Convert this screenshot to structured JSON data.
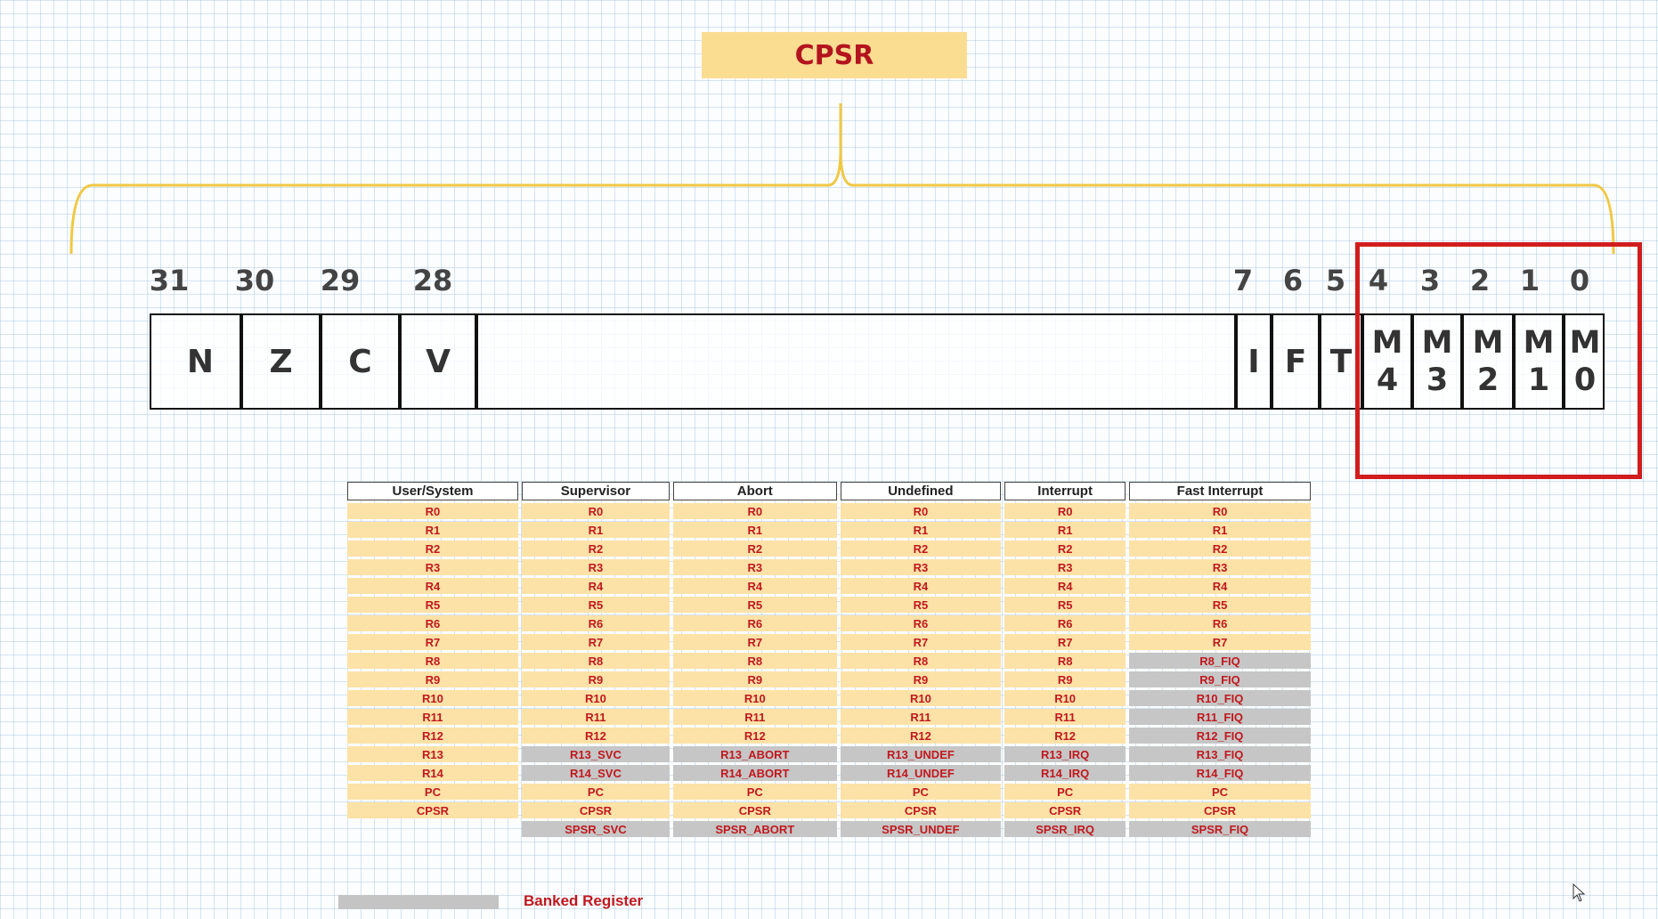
{
  "title": "CPSR",
  "bit_numbers": [
    "31",
    "30",
    "29",
    "28",
    "7",
    "6",
    "5",
    "4",
    "3",
    "2",
    "1",
    "0"
  ],
  "flags": [
    "N",
    "Z",
    "C",
    "V",
    "I",
    "F",
    "T"
  ],
  "mode_bits": [
    {
      "letter": "M",
      "digit": "4"
    },
    {
      "letter": "M",
      "digit": "3"
    },
    {
      "letter": "M",
      "digit": "2"
    },
    {
      "letter": "M",
      "digit": "1"
    },
    {
      "letter": "M",
      "digit": "0"
    }
  ],
  "table": {
    "headers": [
      "User/System",
      "Supervisor",
      "Abort",
      "Undefined",
      "Interrupt",
      "Fast Interrupt"
    ],
    "rows": [
      [
        {
          "t": "R0",
          "k": "u"
        },
        {
          "t": "R0",
          "k": "u"
        },
        {
          "t": "R0",
          "k": "u"
        },
        {
          "t": "R0",
          "k": "u"
        },
        {
          "t": "R0",
          "k": "u"
        },
        {
          "t": "R0",
          "k": "u"
        }
      ],
      [
        {
          "t": "R1",
          "k": "u"
        },
        {
          "t": "R1",
          "k": "u"
        },
        {
          "t": "R1",
          "k": "u"
        },
        {
          "t": "R1",
          "k": "u"
        },
        {
          "t": "R1",
          "k": "u"
        },
        {
          "t": "R1",
          "k": "u"
        }
      ],
      [
        {
          "t": "R2",
          "k": "u"
        },
        {
          "t": "R2",
          "k": "u"
        },
        {
          "t": "R2",
          "k": "u"
        },
        {
          "t": "R2",
          "k": "u"
        },
        {
          "t": "R2",
          "k": "u"
        },
        {
          "t": "R2",
          "k": "u"
        }
      ],
      [
        {
          "t": "R3",
          "k": "u"
        },
        {
          "t": "R3",
          "k": "u"
        },
        {
          "t": "R3",
          "k": "u"
        },
        {
          "t": "R3",
          "k": "u"
        },
        {
          "t": "R3",
          "k": "u"
        },
        {
          "t": "R3",
          "k": "u"
        }
      ],
      [
        {
          "t": "R4",
          "k": "u"
        },
        {
          "t": "R4",
          "k": "u"
        },
        {
          "t": "R4",
          "k": "u"
        },
        {
          "t": "R4",
          "k": "u"
        },
        {
          "t": "R4",
          "k": "u"
        },
        {
          "t": "R4",
          "k": "u"
        }
      ],
      [
        {
          "t": "R5",
          "k": "u"
        },
        {
          "t": "R5",
          "k": "u"
        },
        {
          "t": "R5",
          "k": "u"
        },
        {
          "t": "R5",
          "k": "u"
        },
        {
          "t": "R5",
          "k": "u"
        },
        {
          "t": "R5",
          "k": "u"
        }
      ],
      [
        {
          "t": "R6",
          "k": "u"
        },
        {
          "t": "R6",
          "k": "u"
        },
        {
          "t": "R6",
          "k": "u"
        },
        {
          "t": "R6",
          "k": "u"
        },
        {
          "t": "R6",
          "k": "u"
        },
        {
          "t": "R6",
          "k": "u"
        }
      ],
      [
        {
          "t": "R7",
          "k": "u"
        },
        {
          "t": "R7",
          "k": "u"
        },
        {
          "t": "R7",
          "k": "u"
        },
        {
          "t": "R7",
          "k": "u"
        },
        {
          "t": "R7",
          "k": "u"
        },
        {
          "t": "R7",
          "k": "u"
        }
      ],
      [
        {
          "t": "R8",
          "k": "u"
        },
        {
          "t": "R8",
          "k": "u"
        },
        {
          "t": "R8",
          "k": "u"
        },
        {
          "t": "R8",
          "k": "u"
        },
        {
          "t": "R8",
          "k": "u"
        },
        {
          "t": "R8_FIQ",
          "k": "b"
        }
      ],
      [
        {
          "t": "R9",
          "k": "u"
        },
        {
          "t": "R9",
          "k": "u"
        },
        {
          "t": "R9",
          "k": "u"
        },
        {
          "t": "R9",
          "k": "u"
        },
        {
          "t": "R9",
          "k": "u"
        },
        {
          "t": "R9_FIQ",
          "k": "b"
        }
      ],
      [
        {
          "t": "R10",
          "k": "u"
        },
        {
          "t": "R10",
          "k": "u"
        },
        {
          "t": "R10",
          "k": "u"
        },
        {
          "t": "R10",
          "k": "u"
        },
        {
          "t": "R10",
          "k": "u"
        },
        {
          "t": "R10_FIQ",
          "k": "b"
        }
      ],
      [
        {
          "t": "R11",
          "k": "u"
        },
        {
          "t": "R11",
          "k": "u"
        },
        {
          "t": "R11",
          "k": "u"
        },
        {
          "t": "R11",
          "k": "u"
        },
        {
          "t": "R11",
          "k": "u"
        },
        {
          "t": "R11_FIQ",
          "k": "b"
        }
      ],
      [
        {
          "t": "R12",
          "k": "u"
        },
        {
          "t": "R12",
          "k": "u"
        },
        {
          "t": "R12",
          "k": "u"
        },
        {
          "t": "R12",
          "k": "u"
        },
        {
          "t": "R12",
          "k": "u"
        },
        {
          "t": "R12_FIQ",
          "k": "b"
        }
      ],
      [
        {
          "t": "R13",
          "k": "u"
        },
        {
          "t": "R13_SVC",
          "k": "b"
        },
        {
          "t": "R13_ABORT",
          "k": "b"
        },
        {
          "t": "R13_UNDEF",
          "k": "b"
        },
        {
          "t": "R13_IRQ",
          "k": "b"
        },
        {
          "t": "R13_FIQ",
          "k": "b"
        }
      ],
      [
        {
          "t": "R14",
          "k": "u"
        },
        {
          "t": "R14_SVC",
          "k": "b"
        },
        {
          "t": "R14_ABORT",
          "k": "b"
        },
        {
          "t": "R14_UNDEF",
          "k": "b"
        },
        {
          "t": "R14_IRQ",
          "k": "b"
        },
        {
          "t": "R14_FIQ",
          "k": "b"
        }
      ],
      [
        {
          "t": "PC",
          "k": "u"
        },
        {
          "t": "PC",
          "k": "u"
        },
        {
          "t": "PC",
          "k": "u"
        },
        {
          "t": "PC",
          "k": "u"
        },
        {
          "t": "PC",
          "k": "u"
        },
        {
          "t": "PC",
          "k": "u"
        }
      ],
      [
        {
          "t": "CPSR",
          "k": "u"
        },
        {
          "t": "CPSR",
          "k": "u"
        },
        {
          "t": "CPSR",
          "k": "u"
        },
        {
          "t": "CPSR",
          "k": "u"
        },
        {
          "t": "CPSR",
          "k": "u"
        },
        {
          "t": "CPSR",
          "k": "u"
        }
      ],
      [
        {
          "t": "",
          "k": "e"
        },
        {
          "t": "SPSR_SVC",
          "k": "b"
        },
        {
          "t": "SPSR_ABORT",
          "k": "b"
        },
        {
          "t": "SPSR_UNDEF",
          "k": "b"
        },
        {
          "t": "SPSR_IRQ",
          "k": "b"
        },
        {
          "t": "SPSR_FIQ",
          "k": "b"
        }
      ]
    ]
  },
  "legend": {
    "label": "Banked Register"
  },
  "colors": {
    "user_cell": "#fde2a7",
    "banked_cell": "#c6c6c6",
    "register_text": "#c0181e",
    "highlight_border": "#d11d1d",
    "brace": "#f0c842"
  }
}
